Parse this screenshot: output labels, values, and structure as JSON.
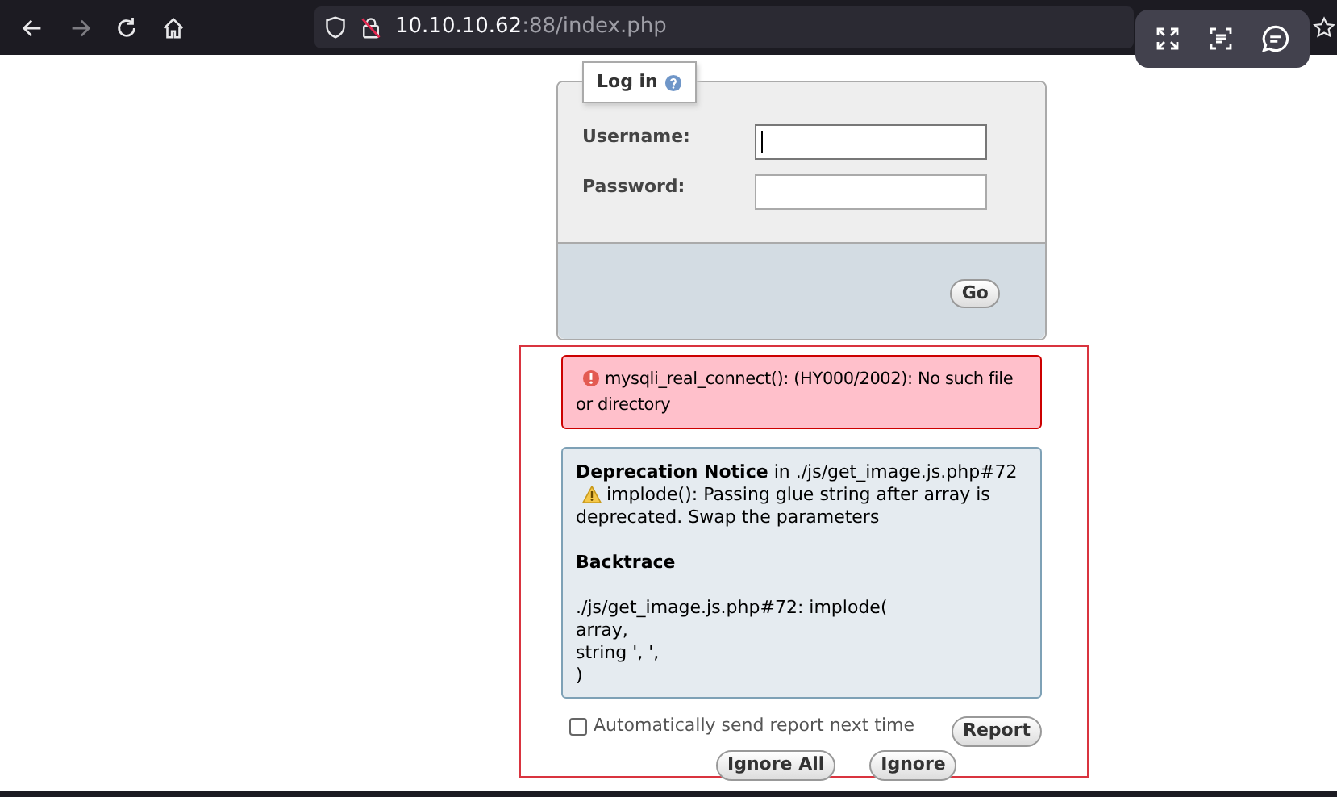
{
  "browser": {
    "url_host": "10.10.10.62",
    "url_rest": ":88/index.php"
  },
  "login": {
    "legend": "Log in",
    "fields": [
      {
        "label": "Username:",
        "focused": true
      },
      {
        "label": "Password:",
        "focused": false
      }
    ],
    "submit": "Go"
  },
  "error": {
    "message": "mysqli_real_connect(): (HY000/2002): No such file or directory"
  },
  "notice": {
    "title": "Deprecation Notice",
    "location": "in ./js/get_image.js.php#72",
    "message": "implode(): Passing glue string after array is deprecated. Swap the parameters",
    "backtrace_title": "Backtrace",
    "backtrace_lines": [
      "./js/get_image.js.php#72: implode(",
      "array,",
      "string ', ',",
      ")"
    ]
  },
  "auto_report": {
    "label": "Automatically send report next time",
    "checked": false
  },
  "report_button": "Report",
  "buttons": [
    "Ignore All",
    "Ignore"
  ]
}
